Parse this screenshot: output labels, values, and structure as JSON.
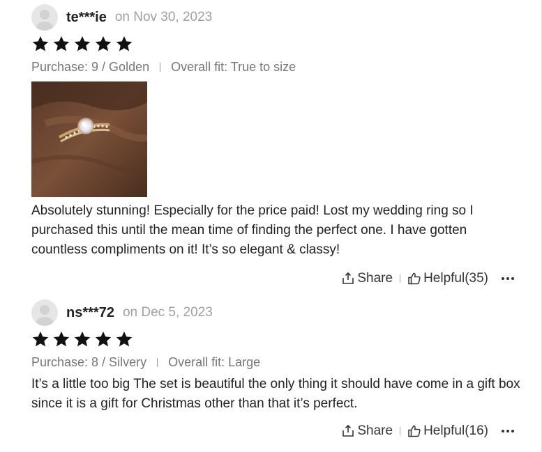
{
  "reviews": [
    {
      "username": "te***ie",
      "date": "on Nov 30, 2023",
      "rating": 5,
      "purchase": "Purchase: 9 / Golden",
      "fit": "Overall fit: True to size",
      "text": "Absolutely stunning! Especially for the price paid! Lost my wedding ring so I purchased this until the mean time of finding the perfect one. I have gotten countless compliments on it! It’s so elegant & classy!",
      "share_label": "Share",
      "helpful_label": "Helpful(35)"
    },
    {
      "username": "ns***72",
      "date": "on Dec 5, 2023",
      "rating": 5,
      "purchase": "Purchase: 8 / Silvery",
      "fit": "Overall fit: Large",
      "text": "It’s a little too big The set is beautiful the only thing it should have come in a gift box since it is a gift for Christmas other than that it’s perfect.",
      "share_label": "Share",
      "helpful_label": "Helpful(16)"
    }
  ],
  "icons": {
    "star": "star-icon",
    "share": "share-icon",
    "helpful": "thumbs-up-icon",
    "more": "more-dots-icon",
    "avatar": "user-avatar-icon"
  },
  "colors": {
    "star": "#111111",
    "date": "#a0a0a0",
    "meta": "#777777"
  }
}
